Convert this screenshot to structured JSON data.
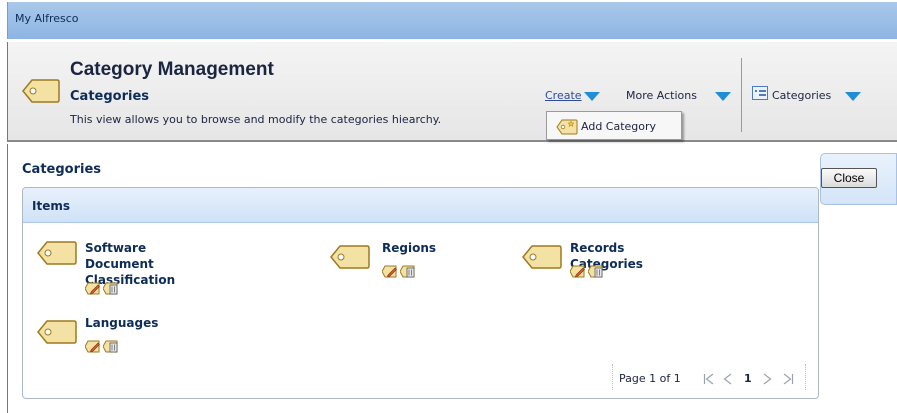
{
  "app": {
    "title": "My Alfresco"
  },
  "header": {
    "title": "Category Management",
    "subtitle": "Categories",
    "description": "This view allows you to browse and modify the categories hiearchy.",
    "create_label": "Create",
    "more_actions_label": "More Actions",
    "view_label": "Categories"
  },
  "create_menu": {
    "add_category_label": "Add Category"
  },
  "content": {
    "title": "Categories",
    "panel_title": "Items",
    "items": [
      {
        "name_line1": "Software Document",
        "name_line2": "Classification"
      },
      {
        "name_line1": "Regions",
        "name_line2": ""
      },
      {
        "name_line1": "Records Categories",
        "name_line2": ""
      },
      {
        "name_line1": "Languages",
        "name_line2": ""
      }
    ]
  },
  "pager": {
    "page_text": "Page 1 of 1",
    "current_page": "1"
  },
  "actions": {
    "close_label": "Close"
  },
  "colors": {
    "accent": "#1f8ed6",
    "tag_fill": "#f3e2a4",
    "tag_stroke": "#9c7a1e",
    "heading": "#0d2c57"
  }
}
